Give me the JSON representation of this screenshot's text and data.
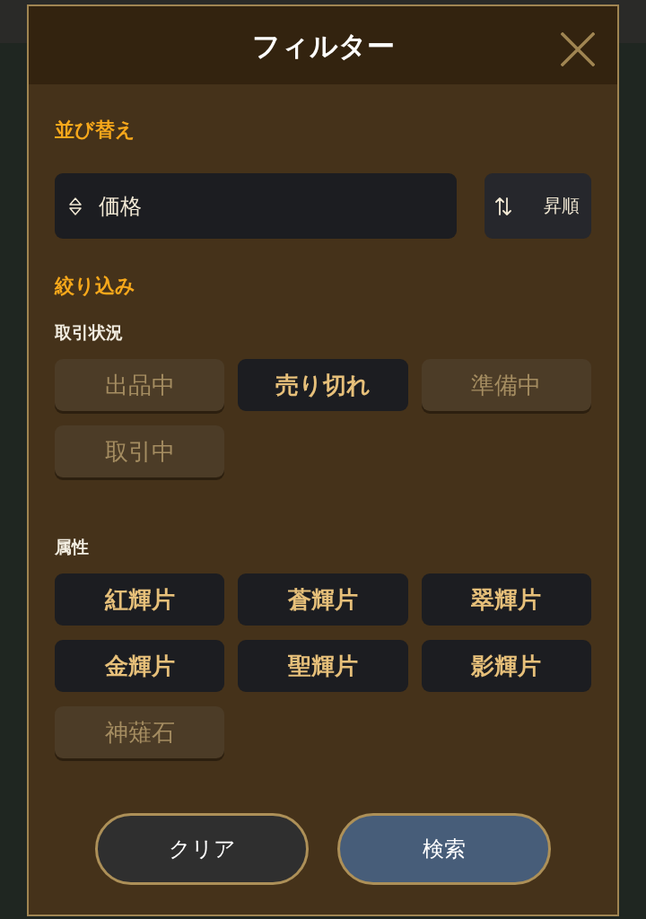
{
  "dialog": {
    "title": "フィルター"
  },
  "sort": {
    "heading": "並び替え",
    "field": {
      "value": "価格"
    },
    "order": {
      "label": "昇順"
    }
  },
  "filter": {
    "heading": "絞り込み",
    "groups": [
      {
        "label": "取引状況",
        "options": [
          {
            "label": "出品中",
            "selected": false
          },
          {
            "label": "売り切れ",
            "selected": true
          },
          {
            "label": "準備中",
            "selected": false
          },
          {
            "label": "取引中",
            "selected": false
          }
        ]
      },
      {
        "label": "属性",
        "options": [
          {
            "label": "紅輝片",
            "selected": true
          },
          {
            "label": "蒼輝片",
            "selected": true
          },
          {
            "label": "翠輝片",
            "selected": true
          },
          {
            "label": "金輝片",
            "selected": true
          },
          {
            "label": "聖輝片",
            "selected": true
          },
          {
            "label": "影輝片",
            "selected": true
          },
          {
            "label": "神薙石",
            "selected": false
          }
        ]
      }
    ]
  },
  "buttons": [
    {
      "label": "クリア",
      "kind": "secondary"
    },
    {
      "label": "検索",
      "kind": "primary"
    }
  ]
}
